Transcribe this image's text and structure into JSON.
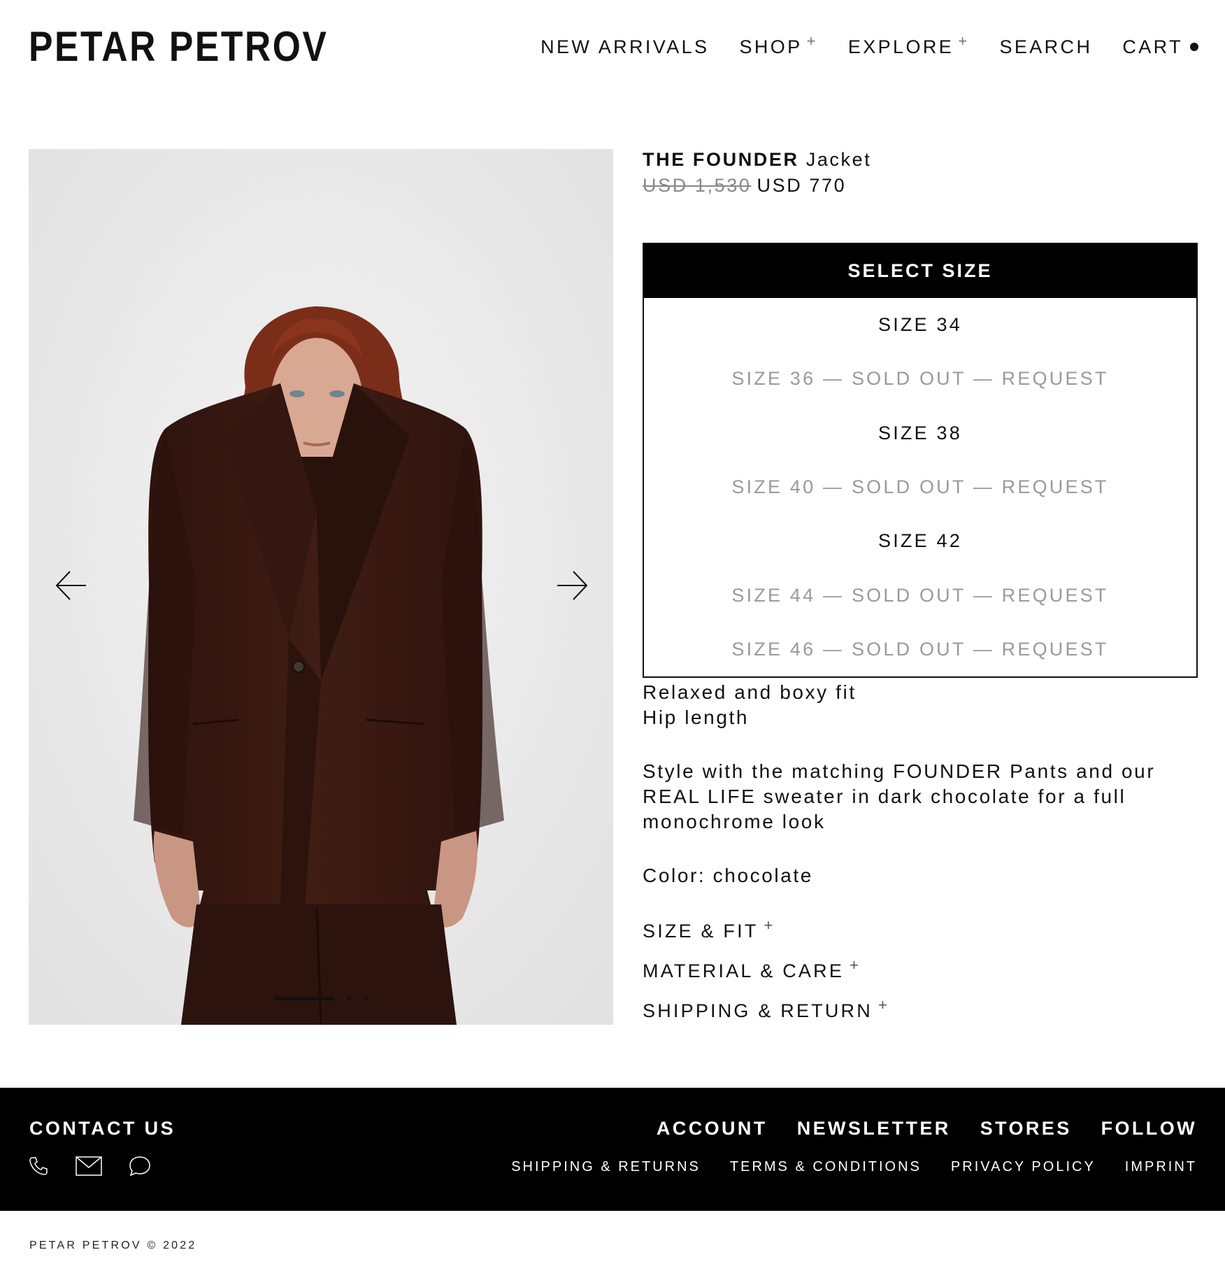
{
  "header": {
    "logo": "PETAR PETROV",
    "nav": [
      {
        "label": "NEW ARRIVALS",
        "has_plus": false
      },
      {
        "label": "SHOP",
        "has_plus": true
      },
      {
        "label": "EXPLORE",
        "has_plus": true
      },
      {
        "label": "SEARCH",
        "has_plus": false
      },
      {
        "label": "CART",
        "has_plus": false
      }
    ],
    "plus_icon": "+"
  },
  "gallery": {
    "slide_count": 3,
    "active_slide": 1
  },
  "product": {
    "title_main": "THE FOUNDER",
    "title_rest": "Jacket",
    "price_old": "USD 1,530",
    "price_new": "USD 770",
    "select_size_label": "SELECT SIZE",
    "sizes": [
      {
        "label": "SIZE 34",
        "available": true
      },
      {
        "label": "SIZE 36 — SOLD OUT — REQUEST",
        "available": false
      },
      {
        "label": "SIZE 38",
        "available": true
      },
      {
        "label": "SIZE 40 — SOLD OUT — REQUEST",
        "available": false
      },
      {
        "label": "SIZE 42",
        "available": true
      },
      {
        "label": "SIZE 44 — SOLD OUT — REQUEST",
        "available": false
      },
      {
        "label": "SIZE 46 — SOLD OUT — REQUEST",
        "available": false
      }
    ],
    "description": {
      "line1": "Relaxed and boxy fit",
      "line2": "Hip length",
      "paragraph": "Style with the matching FOUNDER Pants and our REAL LIFE sweater in dark chocolate for a full monochrome look",
      "color": "Color: chocolate"
    },
    "accordion": [
      {
        "label": "SIZE & FIT"
      },
      {
        "label": "MATERIAL & CARE"
      },
      {
        "label": "SHIPPING & RETURN"
      }
    ]
  },
  "footer": {
    "contact_title": "CONTACT US",
    "contact_icons": [
      "phone-icon",
      "mail-icon",
      "chat-icon"
    ],
    "nav": [
      "ACCOUNT",
      "NEWSLETTER",
      "STORES",
      "FOLLOW"
    ],
    "links": [
      "SHIPPING & RETURNS",
      "TERMS & CONDITIONS",
      "PRIVACY POLICY",
      "IMPRINT"
    ]
  },
  "copyright": "PETAR PETROV © 2022",
  "colors": {
    "text": "#111111",
    "soldout": "#9a9a9a",
    "footer_bg": "#000000",
    "jacket": "#3a1a12"
  }
}
